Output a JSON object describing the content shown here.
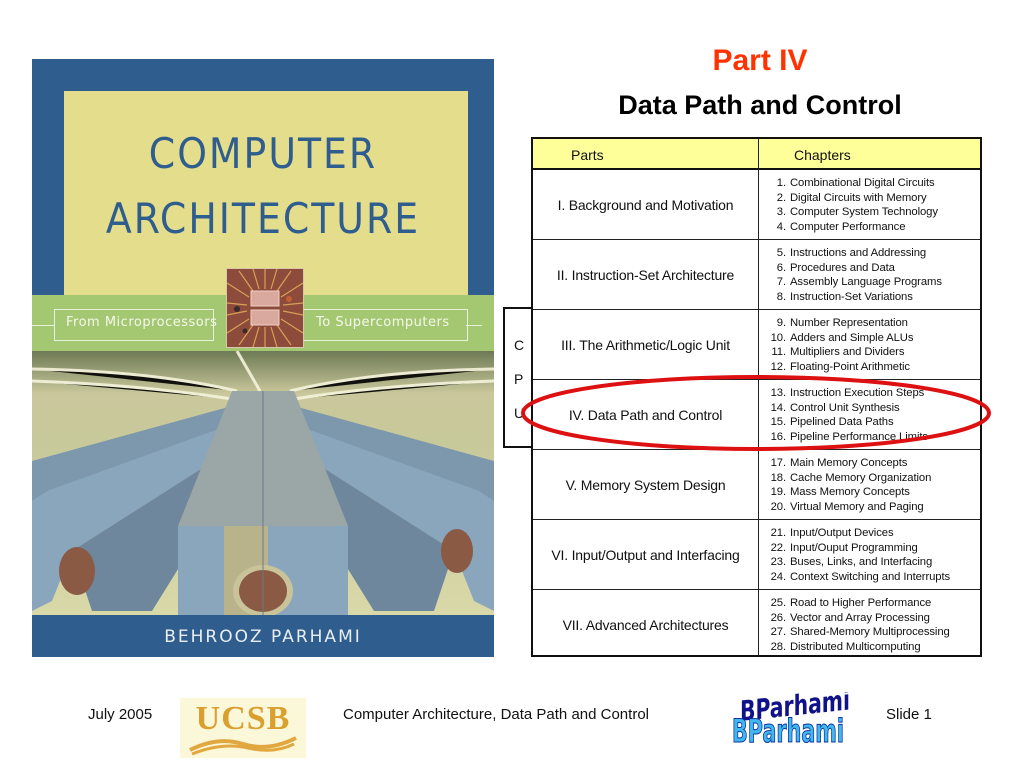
{
  "cover": {
    "title_line1": "COMPUTER",
    "title_line2": "ARCHITECTURE",
    "band_left": "From Microprocessors",
    "band_right": "To Supercomputers",
    "author": "BEHROOZ PARHAMI",
    "colors": {
      "blue": "#2f5d8e",
      "panel": "#e3dd8c",
      "band": "#a4c771"
    }
  },
  "slide": {
    "part_title": "Part IV",
    "subtitle": "Data Path and Control",
    "title_color": "#ff3300"
  },
  "table": {
    "headers": {
      "parts": "Parts",
      "chapters": "Chapters"
    },
    "header_color": "#ffff99",
    "rows": [
      {
        "part": "I. Background and Motivation",
        "chapters": [
          {
            "n": "1.",
            "t": "Combinational Digital Circuits"
          },
          {
            "n": "2.",
            "t": "Digital Circuits with Memory"
          },
          {
            "n": "3.",
            "t": "Computer System Technology"
          },
          {
            "n": "4.",
            "t": "Computer Performance"
          }
        ]
      },
      {
        "part": "II. Instruction-Set Architecture",
        "chapters": [
          {
            "n": "5.",
            "t": "Instructions and Addressing"
          },
          {
            "n": "6.",
            "t": "Procedures and Data"
          },
          {
            "n": "7.",
            "t": "Assembly Language Programs"
          },
          {
            "n": "8.",
            "t": "Instruction-Set Variations"
          }
        ]
      },
      {
        "part": "III. The Arithmetic/Logic Unit",
        "chapters": [
          {
            "n": "9.",
            "t": "Number Representation"
          },
          {
            "n": "10.",
            "t": "Adders and Simple ALUs"
          },
          {
            "n": "11.",
            "t": "Multipliers and Dividers"
          },
          {
            "n": "12.",
            "t": "Floating-Point Arithmetic"
          }
        ]
      },
      {
        "part": "IV. Data Path and Control",
        "highlighted": true,
        "chapters": [
          {
            "n": "13.",
            "t": "Instruction Execution Steps"
          },
          {
            "n": "14.",
            "t": "Control Unit Synthesis"
          },
          {
            "n": "15.",
            "t": "Pipelined Data Paths"
          },
          {
            "n": "16.",
            "t": "Pipeline Performance Limits"
          }
        ]
      },
      {
        "part": "V. Memory System Design",
        "chapters": [
          {
            "n": "17.",
            "t": "Main Memory Concepts"
          },
          {
            "n": "18.",
            "t": "Cache Memory Organization"
          },
          {
            "n": "19.",
            "t": "Mass Memory Concepts"
          },
          {
            "n": "20.",
            "t": "Virtual Memory and Paging"
          }
        ]
      },
      {
        "part": "VI. Input/Output and Interfacing",
        "chapters": [
          {
            "n": "21.",
            "t": "Input/Output Devices"
          },
          {
            "n": "22.",
            "t": "Input/Ouput Programming"
          },
          {
            "n": "23.",
            "t": "Buses, Links, and Interfacing"
          },
          {
            "n": "24.",
            "t": "Context Switching and Interrupts"
          }
        ]
      },
      {
        "part": "VII. Advanced Architectures",
        "chapters": [
          {
            "n": "25.",
            "t": "Road to Higher Performance"
          },
          {
            "n": "26.",
            "t": "Vector and Array Processing"
          },
          {
            "n": "27.",
            "t": "Shared-Memory Multiprocessing"
          },
          {
            "n": "28.",
            "t": "Distributed Multicomputing"
          }
        ]
      }
    ],
    "cpu_label": [
      "C",
      "P",
      "U"
    ],
    "highlight_color": "#dd1111"
  },
  "footer": {
    "date": "July 2005",
    "logo_text": "UCSB",
    "center": "Computer Architecture, Data Path and Control",
    "author_logo": "B Parhami",
    "slide_number": "Slide 1"
  }
}
